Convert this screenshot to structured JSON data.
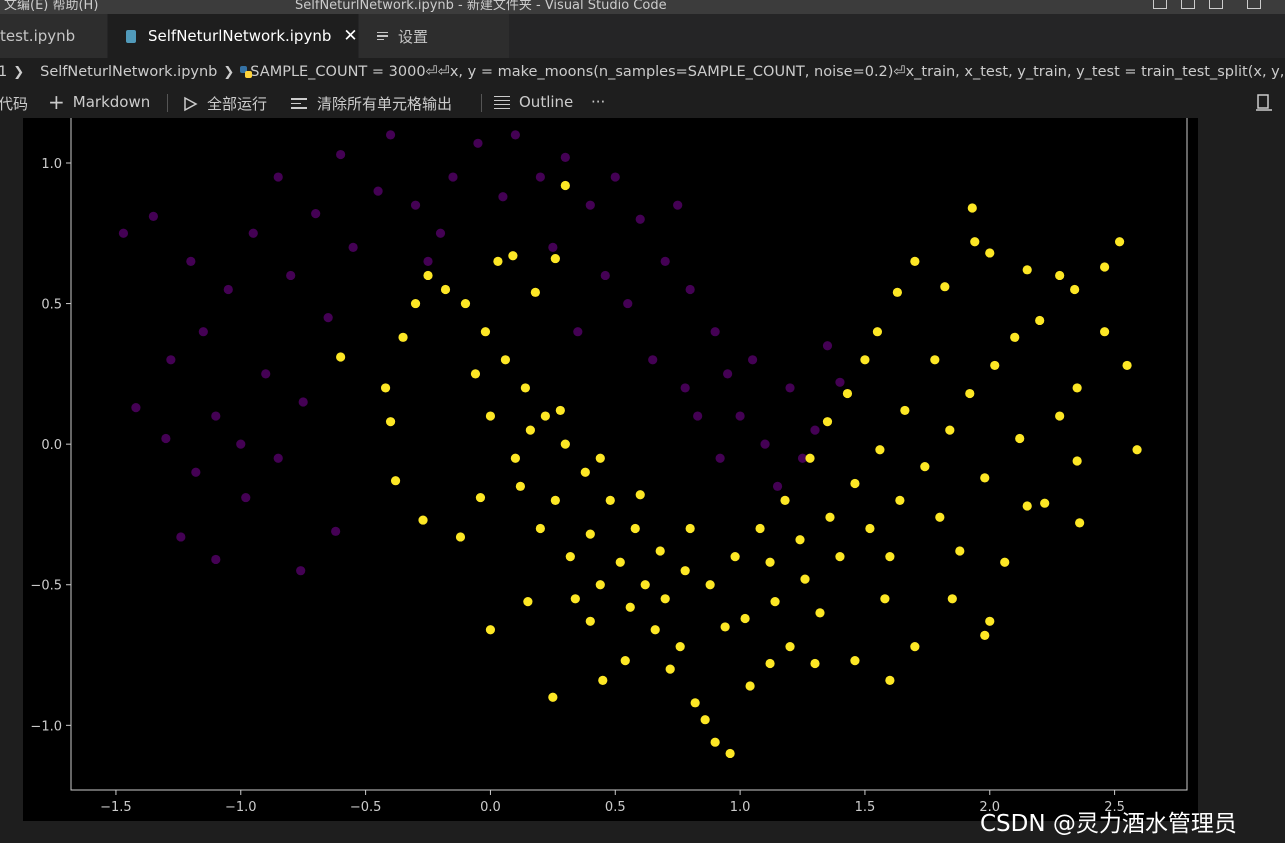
{
  "titlebar": {
    "menu": "文编(E)    帮助(H)",
    "window_title": "SelfNeturlNetwork.ipynb - 新建文件夹 - Visual Studio Code"
  },
  "tabs": [
    {
      "label": "test.ipynb",
      "icon": "notebook-icon",
      "active": false
    },
    {
      "label": "SelfNeturlNetwork.ipynb",
      "icon": "notebook-icon",
      "active": true,
      "close": "✕"
    },
    {
      "label": "设置",
      "icon": "settings-icon",
      "active": false
    }
  ],
  "breadcrumb": {
    "root": "1",
    "file": "SelfNeturlNetwork.ipynb",
    "cell": "SAMPLE_COUNT = 3000⏎⏎x, y = make_moons(n_samples=SAMPLE_COUNT, noise=0.2)⏎x_train, x_test, y_train, y_test = train_test_split(x, y, te"
  },
  "toolbar": {
    "code": "代码",
    "markdown": "Markdown",
    "run_all": "全部运行",
    "clear_outputs": "清除所有单元格输出",
    "outline": "Outline",
    "more": "···"
  },
  "watermark": "CSDN @灵力酒水管理员",
  "colors": {
    "class0": "#440154",
    "class1": "#fde725",
    "axes": "#cccccc",
    "background": "#000000"
  },
  "chart_data": {
    "type": "scatter",
    "title": "",
    "xlabel": "",
    "ylabel": "",
    "xlim": [
      -1.68,
      2.79
    ],
    "ylim": [
      -1.23,
      1.16
    ],
    "x_ticks": [
      -1.5,
      -1.0,
      -0.5,
      0.0,
      0.5,
      1.0,
      1.5,
      2.0,
      2.5
    ],
    "x_tick_labels": [
      "−1.5",
      "−1.0",
      "−0.5",
      "0.0",
      "0.5",
      "1.0",
      "1.5",
      "2.0",
      "2.5"
    ],
    "y_ticks": [
      1.0,
      0.5,
      0.0,
      -0.5,
      -1.0
    ],
    "y_tick_labels": [
      "1.0",
      "0.5",
      "0.0",
      "−0.5",
      "−1.0"
    ],
    "legend": "none",
    "grid": false,
    "source": "make_moons(n_samples=3000, noise=0.2)",
    "series": [
      {
        "class": 0,
        "color": "#440154",
        "points": [
          [
            -1.47,
            0.75
          ],
          [
            -1.35,
            0.81
          ],
          [
            -1.42,
            0.13
          ],
          [
            -1.3,
            0.02
          ],
          [
            -1.24,
            -0.33
          ],
          [
            -1.1,
            -0.41
          ],
          [
            -0.98,
            -0.19
          ],
          [
            -0.76,
            -0.45
          ],
          [
            -0.62,
            -0.31
          ],
          [
            -1.2,
            0.65
          ],
          [
            -1.15,
            0.4
          ],
          [
            -1.05,
            0.55
          ],
          [
            -0.95,
            0.75
          ],
          [
            -0.85,
            0.95
          ],
          [
            -0.8,
            0.6
          ],
          [
            -0.7,
            0.82
          ],
          [
            -0.6,
            1.03
          ],
          [
            -0.55,
            0.7
          ],
          [
            -0.45,
            0.9
          ],
          [
            -0.4,
            1.1
          ],
          [
            -0.3,
            0.85
          ],
          [
            -0.25,
            0.65
          ],
          [
            -0.15,
            0.95
          ],
          [
            -0.05,
            1.07
          ],
          [
            0.05,
            0.88
          ],
          [
            0.1,
            1.1
          ],
          [
            0.2,
            0.95
          ],
          [
            0.3,
            1.02
          ],
          [
            0.4,
            0.85
          ],
          [
            0.5,
            0.95
          ],
          [
            0.6,
            0.8
          ],
          [
            0.7,
            0.65
          ],
          [
            0.75,
            0.85
          ],
          [
            0.8,
            0.55
          ],
          [
            0.9,
            0.4
          ],
          [
            0.95,
            0.25
          ],
          [
            1.0,
            0.1
          ],
          [
            1.05,
            0.3
          ],
          [
            1.1,
            0.0
          ],
          [
            1.2,
            0.2
          ],
          [
            1.3,
            0.05
          ],
          [
            1.35,
            0.35
          ],
          [
            1.4,
            0.22
          ],
          [
            0.65,
            0.3
          ],
          [
            0.55,
            0.5
          ],
          [
            -1.1,
            0.1
          ],
          [
            -1.0,
            0.0
          ],
          [
            -0.9,
            0.25
          ],
          [
            -0.85,
            -0.05
          ],
          [
            -0.75,
            0.15
          ],
          [
            -0.65,
            0.45
          ],
          [
            -1.28,
            0.3
          ],
          [
            -1.18,
            -0.1
          ],
          [
            0.83,
            0.1
          ],
          [
            0.92,
            -0.05
          ],
          [
            1.15,
            -0.15
          ],
          [
            1.25,
            -0.05
          ],
          [
            0.78,
            0.2
          ],
          [
            0.46,
            0.6
          ],
          [
            0.35,
            0.4
          ],
          [
            0.25,
            0.7
          ],
          [
            -0.2,
            0.75
          ]
        ]
      },
      {
        "class": 1,
        "color": "#fde725",
        "points": [
          [
            -0.4,
            0.08
          ],
          [
            -0.38,
            -0.13
          ],
          [
            -0.27,
            -0.27
          ],
          [
            -0.12,
            -0.33
          ],
          [
            -0.04,
            -0.19
          ],
          [
            0.0,
            -0.66
          ],
          [
            0.15,
            -0.56
          ],
          [
            0.25,
            -0.9
          ],
          [
            0.45,
            -0.84
          ],
          [
            0.4,
            -0.63
          ],
          [
            0.54,
            -0.77
          ],
          [
            0.72,
            -0.8
          ],
          [
            0.82,
            -0.92
          ],
          [
            0.86,
            -0.98
          ],
          [
            0.9,
            -1.06
          ],
          [
            0.96,
            -1.1
          ],
          [
            1.04,
            -0.86
          ],
          [
            1.12,
            -0.78
          ],
          [
            1.2,
            -0.72
          ],
          [
            1.3,
            -0.78
          ],
          [
            1.46,
            -0.77
          ],
          [
            1.6,
            -0.84
          ],
          [
            1.7,
            -0.72
          ],
          [
            1.85,
            -0.55
          ],
          [
            2.0,
            -0.63
          ],
          [
            1.98,
            -0.68
          ],
          [
            2.06,
            -0.42
          ],
          [
            2.15,
            -0.22
          ],
          [
            2.22,
            -0.21
          ],
          [
            2.36,
            -0.28
          ],
          [
            2.35,
            -0.06
          ],
          [
            2.35,
            0.2
          ],
          [
            2.46,
            0.4
          ],
          [
            2.55,
            0.28
          ],
          [
            2.59,
            -0.02
          ],
          [
            2.46,
            0.63
          ],
          [
            2.52,
            0.72
          ],
          [
            2.34,
            0.55
          ],
          [
            2.28,
            0.6
          ],
          [
            2.15,
            0.62
          ],
          [
            2.0,
            0.68
          ],
          [
            1.94,
            0.72
          ],
          [
            1.93,
            0.84
          ],
          [
            1.7,
            0.65
          ],
          [
            1.82,
            0.56
          ],
          [
            1.63,
            0.54
          ],
          [
            1.55,
            0.4
          ],
          [
            1.5,
            0.3
          ],
          [
            1.43,
            0.18
          ],
          [
            1.35,
            0.08
          ],
          [
            1.28,
            -0.05
          ],
          [
            1.18,
            -0.2
          ],
          [
            1.08,
            -0.3
          ],
          [
            0.98,
            -0.4
          ],
          [
            0.88,
            -0.5
          ],
          [
            0.78,
            -0.45
          ],
          [
            0.68,
            -0.38
          ],
          [
            0.58,
            -0.3
          ],
          [
            0.48,
            -0.2
          ],
          [
            0.38,
            -0.1
          ],
          [
            0.3,
            0.0
          ],
          [
            0.22,
            0.1
          ],
          [
            0.14,
            0.2
          ],
          [
            0.06,
            0.3
          ],
          [
            -0.02,
            0.4
          ],
          [
            -0.1,
            0.5
          ],
          [
            -0.18,
            0.55
          ],
          [
            -0.25,
            0.6
          ],
          [
            -0.3,
            0.5
          ],
          [
            -0.35,
            0.38
          ],
          [
            -0.42,
            0.2
          ],
          [
            -0.6,
            0.31
          ],
          [
            0.03,
            0.65
          ],
          [
            0.09,
            0.67
          ],
          [
            0.18,
            0.54
          ],
          [
            0.26,
            0.66
          ],
          [
            0.3,
            0.92
          ],
          [
            0.12,
            -0.15
          ],
          [
            0.2,
            -0.3
          ],
          [
            0.32,
            -0.4
          ],
          [
            0.44,
            -0.5
          ],
          [
            0.56,
            -0.58
          ],
          [
            0.66,
            -0.66
          ],
          [
            0.76,
            -0.72
          ],
          [
            1.02,
            -0.62
          ],
          [
            1.14,
            -0.56
          ],
          [
            1.26,
            -0.48
          ],
          [
            1.4,
            -0.4
          ],
          [
            1.52,
            -0.3
          ],
          [
            1.64,
            -0.2
          ],
          [
            1.74,
            -0.08
          ],
          [
            1.84,
            0.05
          ],
          [
            1.92,
            0.18
          ],
          [
            2.02,
            0.28
          ],
          [
            2.1,
            0.38
          ],
          [
            2.2,
            0.44
          ],
          [
            1.78,
            0.3
          ],
          [
            1.66,
            0.12
          ],
          [
            1.56,
            -0.02
          ],
          [
            1.46,
            -0.14
          ],
          [
            1.36,
            -0.26
          ],
          [
            1.24,
            -0.34
          ],
          [
            1.12,
            -0.42
          ],
          [
            0.62,
            -0.5
          ],
          [
            0.52,
            -0.42
          ],
          [
            0.4,
            -0.32
          ],
          [
            0.26,
            -0.2
          ],
          [
            0.1,
            -0.05
          ],
          [
            0.0,
            0.1
          ],
          [
            -0.06,
            0.25
          ],
          [
            0.16,
            0.05
          ],
          [
            0.34,
            -0.55
          ],
          [
            0.7,
            -0.55
          ],
          [
            0.94,
            -0.65
          ],
          [
            1.32,
            -0.6
          ],
          [
            1.58,
            -0.55
          ],
          [
            1.88,
            -0.38
          ],
          [
            2.28,
            0.1
          ],
          [
            2.12,
            0.02
          ],
          [
            1.98,
            -0.12
          ],
          [
            1.8,
            -0.26
          ],
          [
            1.6,
            -0.4
          ],
          [
            0.8,
            -0.3
          ],
          [
            0.6,
            -0.18
          ],
          [
            0.44,
            -0.05
          ],
          [
            0.28,
            0.12
          ]
        ]
      }
    ]
  }
}
